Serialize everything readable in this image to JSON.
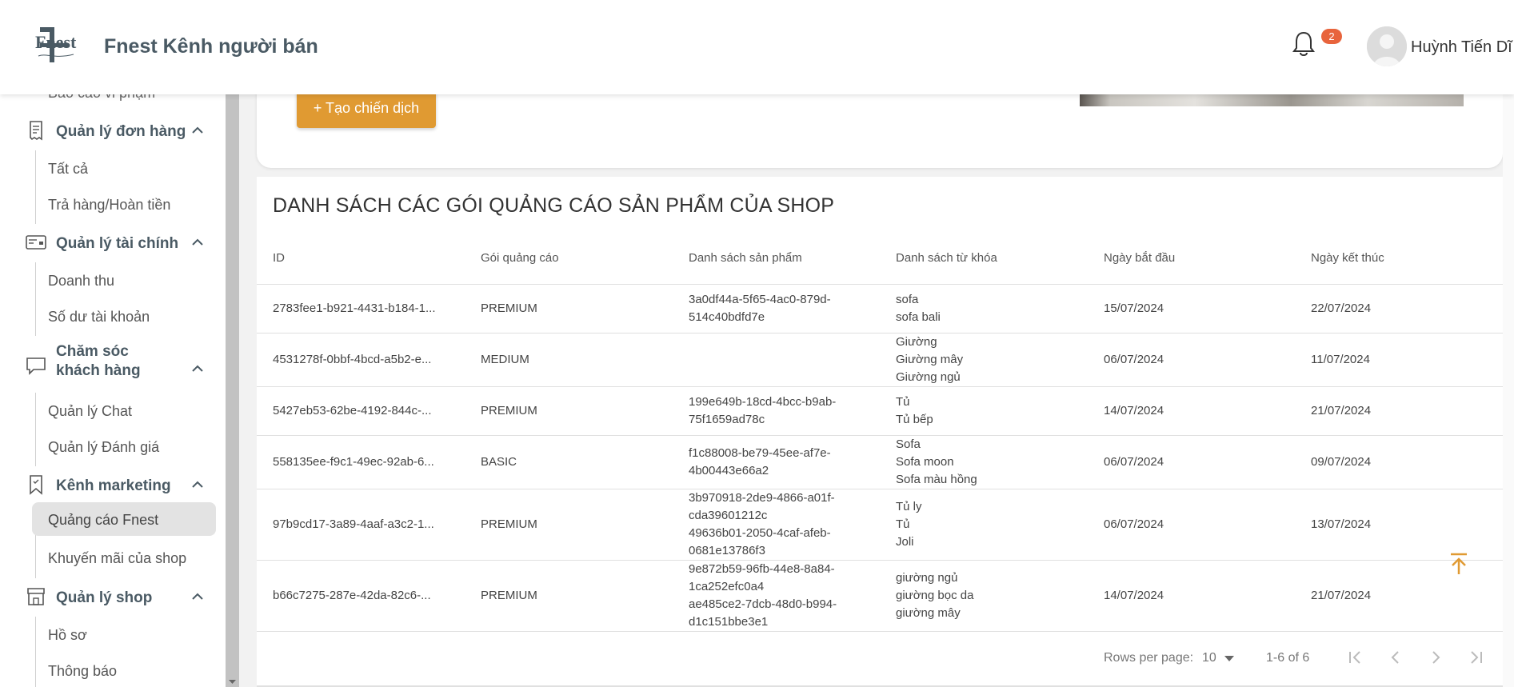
{
  "header": {
    "brand": "Fnest Kênh người bán",
    "logo_text": "Fnest",
    "notification_count": "2",
    "user_name": "Huỳnh Tiến Dĩ"
  },
  "sidebar": {
    "cutoff_item": "Báo cáo vi phạm",
    "groups": [
      {
        "title": "Quản lý đơn hàng",
        "icon": "receipt-icon",
        "items": [
          "Tất cả",
          "Trả hàng/Hoàn tiền"
        ]
      },
      {
        "title": "Quản lý tài chính",
        "icon": "wallet-card-icon",
        "items": [
          "Doanh thu",
          "Số dư tài khoản"
        ]
      },
      {
        "title_line1": "Chăm sóc",
        "title_line2": "khách hàng",
        "icon": "chat-bubble-icon",
        "items": [
          "Quản lý Chat",
          "Quản lý Đánh giá"
        ]
      },
      {
        "title": "Kênh marketing",
        "icon": "bookmark-icon",
        "items": [
          "Quảng cáo Fnest",
          "Khuyến mãi của shop"
        ]
      },
      {
        "title": "Quản lý shop",
        "icon": "store-icon",
        "items": [
          "Hồ sơ",
          "Thông báo"
        ]
      }
    ],
    "active_item": "Quảng cáo Fnest"
  },
  "campaign": {
    "create_button": "+ Tạo chiến dịch"
  },
  "table": {
    "title": "DANH SÁCH CÁC GÓI QUẢNG CÁO SẢN PHẨM CỦA SHOP",
    "columns": [
      "ID",
      "Gói quảng cáo",
      "Danh sách sản phẩm",
      "Danh sách từ khóa",
      "Ngày bắt đầu",
      "Ngày kết thúc"
    ],
    "rows": [
      {
        "id": "2783fee1-b921-4431-b184-1...",
        "package": "PREMIUM",
        "products": [
          "3a0df44a-5f65-4ac0-879d-",
          "514c40bdfd7e"
        ],
        "keywords": [
          "sofa",
          "sofa bali"
        ],
        "start": "15/07/2024",
        "end": "22/07/2024"
      },
      {
        "id": "4531278f-0bbf-4bcd-a5b2-e...",
        "package": "MEDIUM",
        "products": [],
        "keywords": [
          "Giường",
          "Giường mây",
          "Giường ngủ"
        ],
        "start": "06/07/2024",
        "end": "11/07/2024"
      },
      {
        "id": "5427eb53-62be-4192-844c-...",
        "package": "PREMIUM",
        "products": [
          "199e649b-18cd-4bcc-b9ab-",
          "75f1659ad78c"
        ],
        "keywords": [
          "Tủ",
          "Tủ bếp"
        ],
        "start": "14/07/2024",
        "end": "21/07/2024"
      },
      {
        "id": "558135ee-f9c1-49ec-92ab-6...",
        "package": "BASIC",
        "products": [
          "f1c88008-be79-45ee-af7e-",
          "4b00443e66a2"
        ],
        "keywords": [
          "Sofa",
          "Sofa moon",
          "Sofa màu hồng"
        ],
        "start": "06/07/2024",
        "end": "09/07/2024"
      },
      {
        "id": "97b9cd17-3a89-4aaf-a3c2-1...",
        "package": "PREMIUM",
        "products": [
          "3b970918-2de9-4866-a01f-",
          "cda39601212c",
          "49636b01-2050-4caf-afeb-",
          "0681e13786f3"
        ],
        "keywords": [
          "Tủ ly",
          "Tủ",
          "Joli"
        ],
        "start": "06/07/2024",
        "end": "13/07/2024"
      },
      {
        "id": "b66c7275-287e-42da-82c6-...",
        "package": "PREMIUM",
        "products": [
          "9e872b59-96fb-44e8-8a84-",
          "1ca252efc0a4",
          "ae485ce2-7dcb-48d0-b994-",
          "d1c151bbe3e1"
        ],
        "keywords": [
          "giường ngủ",
          "giường bọc da",
          "giường mây"
        ],
        "start": "14/07/2024",
        "end": "21/07/2024"
      }
    ]
  },
  "pagination": {
    "rows_per_page_label": "Rows per page:",
    "rows_per_page": "10",
    "range": "1-6 of 6"
  },
  "colors": {
    "accent": "#e09a32",
    "badge": "#e8643c",
    "sidebar_title": "#4a5a64"
  }
}
